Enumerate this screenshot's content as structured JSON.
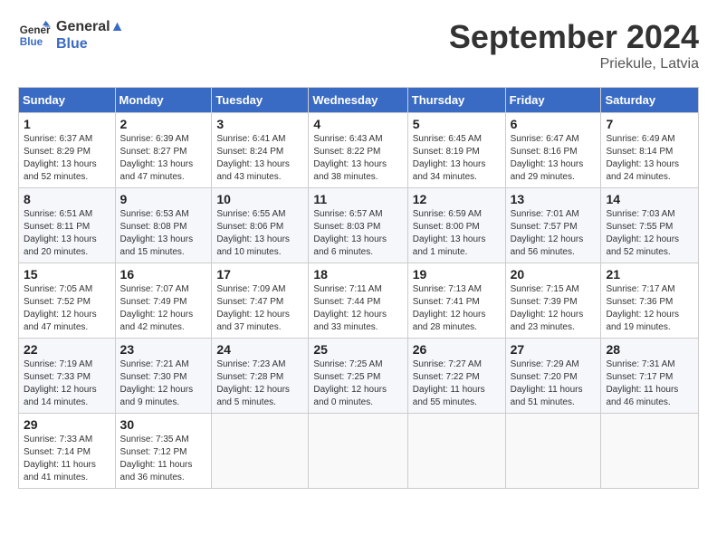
{
  "header": {
    "logo_line1": "General",
    "logo_line2": "Blue",
    "month_title": "September 2024",
    "location": "Priekule, Latvia"
  },
  "days_of_week": [
    "Sunday",
    "Monday",
    "Tuesday",
    "Wednesday",
    "Thursday",
    "Friday",
    "Saturday"
  ],
  "weeks": [
    [
      {
        "day": "1",
        "info": "Sunrise: 6:37 AM\nSunset: 8:29 PM\nDaylight: 13 hours\nand 52 minutes."
      },
      {
        "day": "2",
        "info": "Sunrise: 6:39 AM\nSunset: 8:27 PM\nDaylight: 13 hours\nand 47 minutes."
      },
      {
        "day": "3",
        "info": "Sunrise: 6:41 AM\nSunset: 8:24 PM\nDaylight: 13 hours\nand 43 minutes."
      },
      {
        "day": "4",
        "info": "Sunrise: 6:43 AM\nSunset: 8:22 PM\nDaylight: 13 hours\nand 38 minutes."
      },
      {
        "day": "5",
        "info": "Sunrise: 6:45 AM\nSunset: 8:19 PM\nDaylight: 13 hours\nand 34 minutes."
      },
      {
        "day": "6",
        "info": "Sunrise: 6:47 AM\nSunset: 8:16 PM\nDaylight: 13 hours\nand 29 minutes."
      },
      {
        "day": "7",
        "info": "Sunrise: 6:49 AM\nSunset: 8:14 PM\nDaylight: 13 hours\nand 24 minutes."
      }
    ],
    [
      {
        "day": "8",
        "info": "Sunrise: 6:51 AM\nSunset: 8:11 PM\nDaylight: 13 hours\nand 20 minutes."
      },
      {
        "day": "9",
        "info": "Sunrise: 6:53 AM\nSunset: 8:08 PM\nDaylight: 13 hours\nand 15 minutes."
      },
      {
        "day": "10",
        "info": "Sunrise: 6:55 AM\nSunset: 8:06 PM\nDaylight: 13 hours\nand 10 minutes."
      },
      {
        "day": "11",
        "info": "Sunrise: 6:57 AM\nSunset: 8:03 PM\nDaylight: 13 hours\nand 6 minutes."
      },
      {
        "day": "12",
        "info": "Sunrise: 6:59 AM\nSunset: 8:00 PM\nDaylight: 13 hours\nand 1 minute."
      },
      {
        "day": "13",
        "info": "Sunrise: 7:01 AM\nSunset: 7:57 PM\nDaylight: 12 hours\nand 56 minutes."
      },
      {
        "day": "14",
        "info": "Sunrise: 7:03 AM\nSunset: 7:55 PM\nDaylight: 12 hours\nand 52 minutes."
      }
    ],
    [
      {
        "day": "15",
        "info": "Sunrise: 7:05 AM\nSunset: 7:52 PM\nDaylight: 12 hours\nand 47 minutes."
      },
      {
        "day": "16",
        "info": "Sunrise: 7:07 AM\nSunset: 7:49 PM\nDaylight: 12 hours\nand 42 minutes."
      },
      {
        "day": "17",
        "info": "Sunrise: 7:09 AM\nSunset: 7:47 PM\nDaylight: 12 hours\nand 37 minutes."
      },
      {
        "day": "18",
        "info": "Sunrise: 7:11 AM\nSunset: 7:44 PM\nDaylight: 12 hours\nand 33 minutes."
      },
      {
        "day": "19",
        "info": "Sunrise: 7:13 AM\nSunset: 7:41 PM\nDaylight: 12 hours\nand 28 minutes."
      },
      {
        "day": "20",
        "info": "Sunrise: 7:15 AM\nSunset: 7:39 PM\nDaylight: 12 hours\nand 23 minutes."
      },
      {
        "day": "21",
        "info": "Sunrise: 7:17 AM\nSunset: 7:36 PM\nDaylight: 12 hours\nand 19 minutes."
      }
    ],
    [
      {
        "day": "22",
        "info": "Sunrise: 7:19 AM\nSunset: 7:33 PM\nDaylight: 12 hours\nand 14 minutes."
      },
      {
        "day": "23",
        "info": "Sunrise: 7:21 AM\nSunset: 7:30 PM\nDaylight: 12 hours\nand 9 minutes."
      },
      {
        "day": "24",
        "info": "Sunrise: 7:23 AM\nSunset: 7:28 PM\nDaylight: 12 hours\nand 5 minutes."
      },
      {
        "day": "25",
        "info": "Sunrise: 7:25 AM\nSunset: 7:25 PM\nDaylight: 12 hours\nand 0 minutes."
      },
      {
        "day": "26",
        "info": "Sunrise: 7:27 AM\nSunset: 7:22 PM\nDaylight: 11 hours\nand 55 minutes."
      },
      {
        "day": "27",
        "info": "Sunrise: 7:29 AM\nSunset: 7:20 PM\nDaylight: 11 hours\nand 51 minutes."
      },
      {
        "day": "28",
        "info": "Sunrise: 7:31 AM\nSunset: 7:17 PM\nDaylight: 11 hours\nand 46 minutes."
      }
    ],
    [
      {
        "day": "29",
        "info": "Sunrise: 7:33 AM\nSunset: 7:14 PM\nDaylight: 11 hours\nand 41 minutes."
      },
      {
        "day": "30",
        "info": "Sunrise: 7:35 AM\nSunset: 7:12 PM\nDaylight: 11 hours\nand 36 minutes."
      },
      {
        "day": "",
        "info": ""
      },
      {
        "day": "",
        "info": ""
      },
      {
        "day": "",
        "info": ""
      },
      {
        "day": "",
        "info": ""
      },
      {
        "day": "",
        "info": ""
      }
    ]
  ]
}
